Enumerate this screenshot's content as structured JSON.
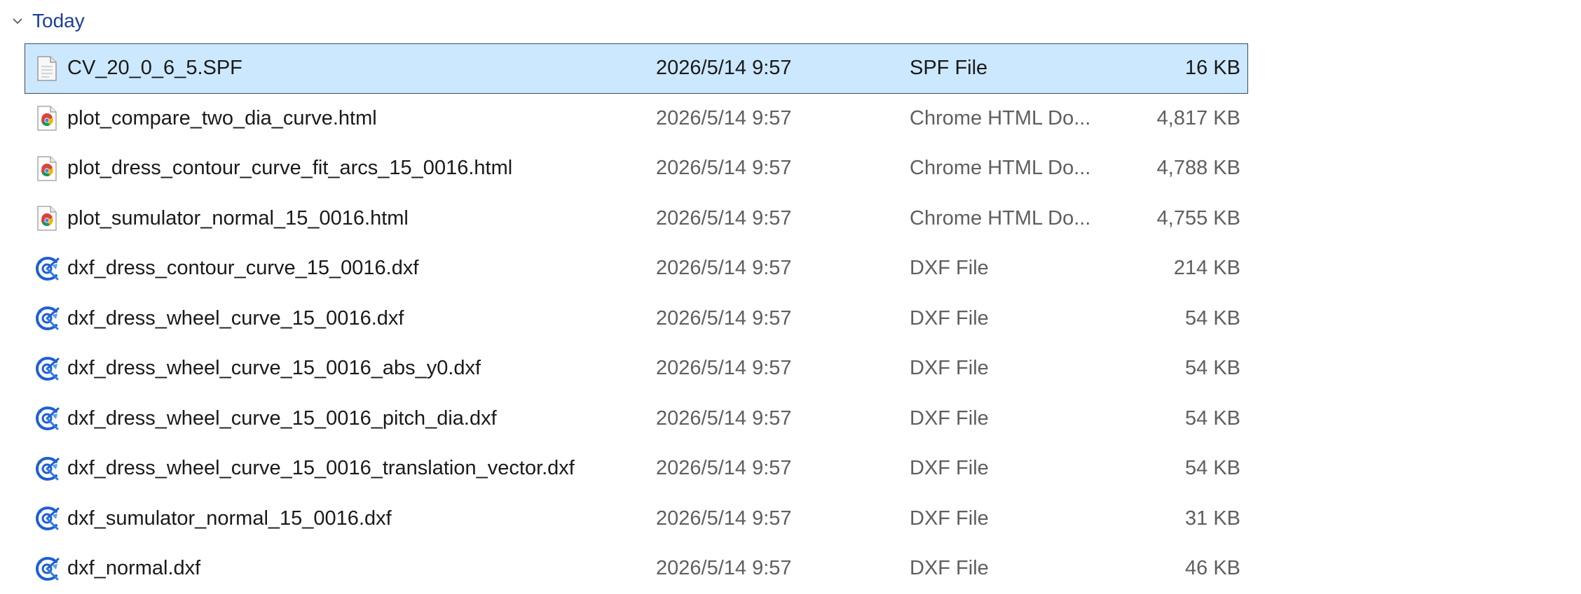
{
  "group": {
    "title": "Today",
    "expanded_icon": "chevron-down-icon"
  },
  "files": [
    {
      "name": "CV_20_0_6_5.SPF",
      "date": "2026/5/14 9:57",
      "type": "SPF File",
      "size": "16 KB",
      "icon": "document-icon",
      "selected": true
    },
    {
      "name": "plot_compare_two_dia_curve.html",
      "date": "2026/5/14 9:57",
      "type": "Chrome HTML Do...",
      "size": "4,817 KB",
      "icon": "chrome-icon",
      "selected": false
    },
    {
      "name": "plot_dress_contour_curve_fit_arcs_15_0016.html",
      "date": "2026/5/14 9:57",
      "type": "Chrome HTML Do...",
      "size": "4,788 KB",
      "icon": "chrome-icon",
      "selected": false
    },
    {
      "name": "plot_sumulator_normal_15_0016.html",
      "date": "2026/5/14 9:57",
      "type": "Chrome HTML Do...",
      "size": "4,755 KB",
      "icon": "chrome-icon",
      "selected": false
    },
    {
      "name": "dxf_dress_contour_curve_15_0016.dxf",
      "date": "2026/5/14 9:57",
      "type": "DXF File",
      "size": "214 KB",
      "icon": "cad-app-icon",
      "selected": false
    },
    {
      "name": "dxf_dress_wheel_curve_15_0016.dxf",
      "date": "2026/5/14 9:57",
      "type": "DXF File",
      "size": "54 KB",
      "icon": "cad-app-icon",
      "selected": false
    },
    {
      "name": "dxf_dress_wheel_curve_15_0016_abs_y0.dxf",
      "date": "2026/5/14 9:57",
      "type": "DXF File",
      "size": "54 KB",
      "icon": "cad-app-icon",
      "selected": false
    },
    {
      "name": "dxf_dress_wheel_curve_15_0016_pitch_dia.dxf",
      "date": "2026/5/14 9:57",
      "type": "DXF File",
      "size": "54 KB",
      "icon": "cad-app-icon",
      "selected": false
    },
    {
      "name": "dxf_dress_wheel_curve_15_0016_translation_vector.dxf",
      "date": "2026/5/14 9:57",
      "type": "DXF File",
      "size": "54 KB",
      "icon": "cad-app-icon",
      "selected": false
    },
    {
      "name": "dxf_sumulator_normal_15_0016.dxf",
      "date": "2026/5/14 9:57",
      "type": "DXF File",
      "size": "31 KB",
      "icon": "cad-app-icon",
      "selected": false
    },
    {
      "name": "dxf_normal.dxf",
      "date": "2026/5/14 9:57",
      "type": "DXF File",
      "size": "46 KB",
      "icon": "cad-app-icon",
      "selected": false
    }
  ],
  "colors": {
    "selected_background": "#cce8ff",
    "selected_border": "#3c4a5c",
    "group_title": "#1b3f9a",
    "secondary_text": "#5f5f5f"
  }
}
